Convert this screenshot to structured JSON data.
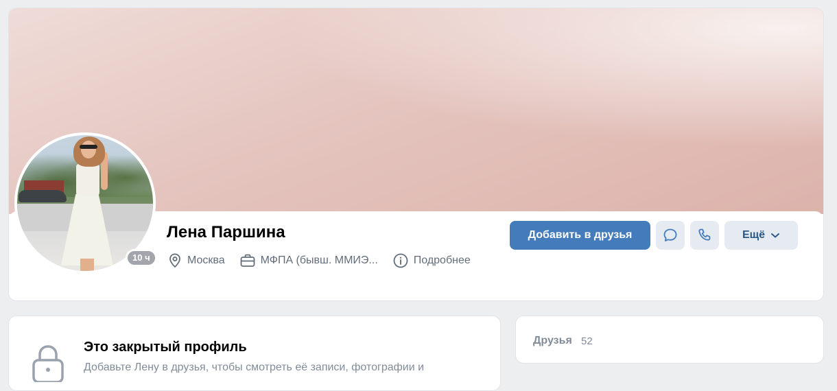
{
  "profile": {
    "name": "Лена Паршина",
    "online_status": "10 ч",
    "location": "Москва",
    "work": "МФПА (бывш. ММИЭ...",
    "more_info_label": "Подробнее"
  },
  "actions": {
    "add_friend_label": "Добавить в друзья",
    "message_icon": "message-icon",
    "call_icon": "phone-icon",
    "more_label": "Ещё"
  },
  "closed_profile": {
    "title": "Это закрытый профиль",
    "description": "Добавьте Лену в друзья, чтобы смотреть её записи, фотографии и"
  },
  "friends": {
    "label": "Друзья",
    "count": "52"
  },
  "colors": {
    "accent": "#447bba",
    "secondary_button": "#e5ebf1",
    "secondary_text": "#2a5885",
    "muted_text": "#818c99",
    "background": "#edeef0"
  }
}
